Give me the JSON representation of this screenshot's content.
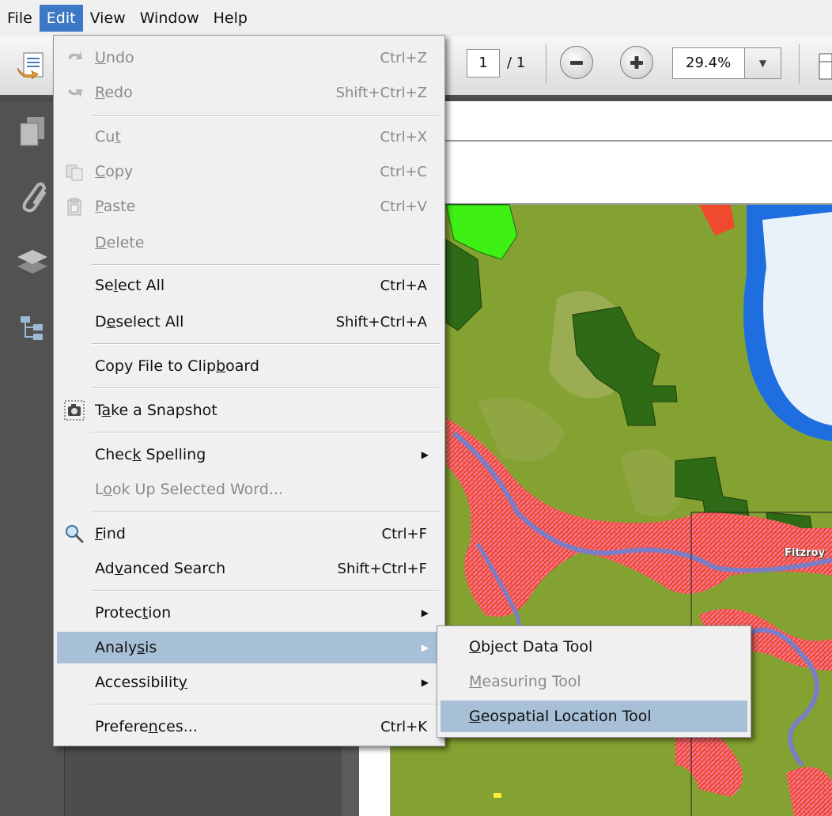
{
  "menubar": {
    "items": [
      {
        "label": "File"
      },
      {
        "label": "Edit"
      },
      {
        "label": "View"
      },
      {
        "label": "Window"
      },
      {
        "label": "Help"
      }
    ]
  },
  "toolbar": {
    "page_current": "1",
    "page_total": "/ 1",
    "zoom": "29.4%"
  },
  "edit_menu": {
    "items": [
      {
        "pre": "",
        "u": "U",
        "post": "ndo",
        "shortcut": "Ctrl+Z",
        "disabled": true
      },
      {
        "pre": "",
        "u": "R",
        "post": "edo",
        "shortcut": "Shift+Ctrl+Z",
        "disabled": true
      },
      {
        "pre": "Cu",
        "u": "t",
        "post": "",
        "shortcut": "Ctrl+X",
        "disabled": true
      },
      {
        "pre": "",
        "u": "C",
        "post": "opy",
        "shortcut": "Ctrl+C",
        "disabled": true
      },
      {
        "pre": "",
        "u": "P",
        "post": "aste",
        "shortcut": "Ctrl+V",
        "disabled": true
      },
      {
        "pre": "",
        "u": "D",
        "post": "elete",
        "shortcut": "",
        "disabled": true
      },
      {
        "pre": "Se",
        "u": "l",
        "post": "ect All",
        "shortcut": "Ctrl+A"
      },
      {
        "pre": "D",
        "u": "e",
        "post": "select All",
        "shortcut": "Shift+Ctrl+A"
      },
      {
        "pre": "Copy File to Clip",
        "u": "b",
        "post": "oard",
        "shortcut": ""
      },
      {
        "pre": "T",
        "u": "a",
        "post": "ke a Snapshot",
        "shortcut": ""
      },
      {
        "pre": "Chec",
        "u": "k",
        "post": " Spelling",
        "shortcut": ""
      },
      {
        "pre": "L",
        "u": "o",
        "post": "ok Up Selected Word...",
        "shortcut": "",
        "disabled": true
      },
      {
        "pre": "",
        "u": "F",
        "post": "ind",
        "shortcut": "Ctrl+F"
      },
      {
        "pre": "Ad",
        "u": "v",
        "post": "anced Search",
        "shortcut": "Shift+Ctrl+F"
      },
      {
        "pre": "Protec",
        "u": "t",
        "post": "ion",
        "shortcut": ""
      },
      {
        "pre": "Analy",
        "u": "s",
        "post": "is",
        "shortcut": ""
      },
      {
        "pre": "Accessibilit",
        "u": "y",
        "post": "",
        "shortcut": ""
      },
      {
        "pre": "Prefere",
        "u": "n",
        "post": "ces...",
        "shortcut": "Ctrl+K"
      }
    ]
  },
  "analysis_submenu": {
    "items": [
      {
        "pre": "",
        "u": "O",
        "post": "bject Data Tool",
        "disabled": false
      },
      {
        "pre": "",
        "u": "M",
        "post": "easuring Tool",
        "disabled": true
      },
      {
        "pre": "",
        "u": "G",
        "post": "eospatial Location Tool",
        "disabled": false
      }
    ]
  },
  "map": {
    "place_label": "Fitzroy"
  },
  "icons": [
    "create-pdf-icon",
    "pages-icon",
    "attachments-icon",
    "layers-icon",
    "model-tree-icon",
    "zoom-out-icon",
    "zoom-in-icon",
    "snapshot-icon",
    "find-icon",
    "undo-icon",
    "redo-icon",
    "copy-icon",
    "paste-icon"
  ]
}
